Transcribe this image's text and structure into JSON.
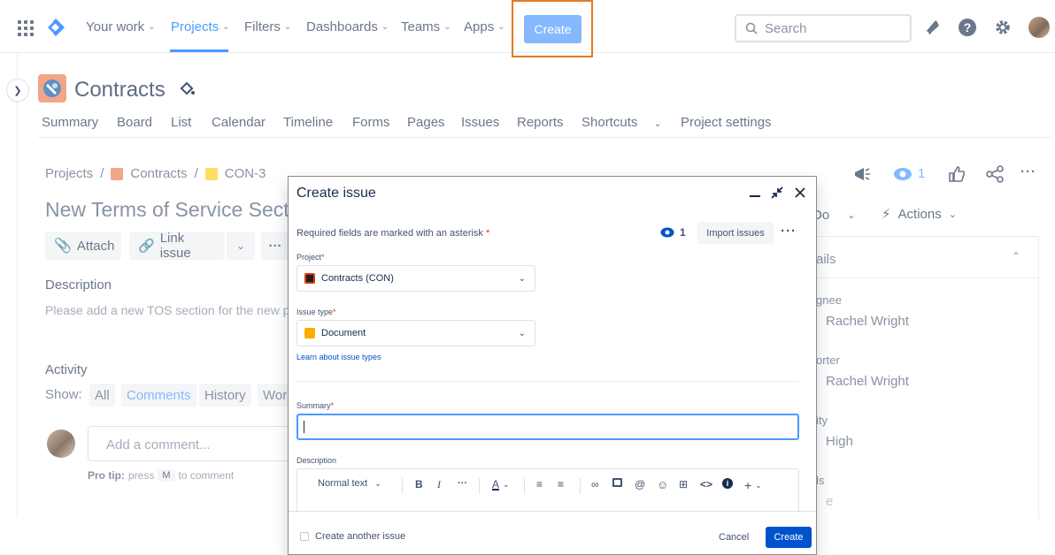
{
  "nav": {
    "items": [
      {
        "label": "Your work"
      },
      {
        "label": "Projects"
      },
      {
        "label": "Filters"
      },
      {
        "label": "Dashboards"
      },
      {
        "label": "Teams"
      },
      {
        "label": "Apps"
      }
    ],
    "create_label": "Create",
    "search_placeholder": "Search",
    "accent": "#4c9aff",
    "highlight_color": "#e07b24"
  },
  "project": {
    "name": "Contracts",
    "tabs": [
      "Summary",
      "Board",
      "List",
      "Calendar",
      "Timeline",
      "Forms",
      "Pages",
      "Issues",
      "Reports",
      "Shortcuts",
      "Project settings"
    ]
  },
  "breadcrumb": {
    "root": "Projects",
    "project": "Contracts",
    "issue_key": "CON-3"
  },
  "issue": {
    "title": "New Terms of Service Sect",
    "attach_label": "Attach",
    "link_issue_label": "Link issue",
    "description_heading": "Description",
    "description_text": "Please add a new TOS section for the new pro",
    "activity_heading": "Activity",
    "show_label": "Show:",
    "filters": [
      "All",
      "Comments",
      "History",
      "Wor"
    ],
    "comment_placeholder": "Add a comment...",
    "protip_bold": "Pro tip:",
    "protip_press": "press",
    "protip_key": "M",
    "protip_rest": "to comment"
  },
  "right_panel": {
    "watch_count": "1",
    "status_label": "Do",
    "actions_label": "Actions",
    "details_heading": "ails",
    "fields": [
      {
        "label": "gnee",
        "value": "Rachel Wright"
      },
      {
        "label": "orter",
        "value": "Rachel Wright"
      },
      {
        "label": "ity",
        "value": "High"
      },
      {
        "label": "ls",
        "value": "e"
      }
    ]
  },
  "modal": {
    "title": "Create issue",
    "required_note": "Required fields are marked with an asterisk",
    "asterisk": "*",
    "watch_count": "1",
    "import_label": "Import issues",
    "project_label": "Project",
    "project_value": "Contracts (CON)",
    "issue_type_label": "Issue type",
    "issue_type_value": "Document",
    "learn_link": "Learn about issue types",
    "summary_label": "Summary",
    "summary_value": "",
    "description_label": "Description",
    "text_style": "Normal text",
    "create_another_label": "Create another issue",
    "cancel_label": "Cancel",
    "create_label": "Create",
    "primary_color": "#0052cc"
  }
}
